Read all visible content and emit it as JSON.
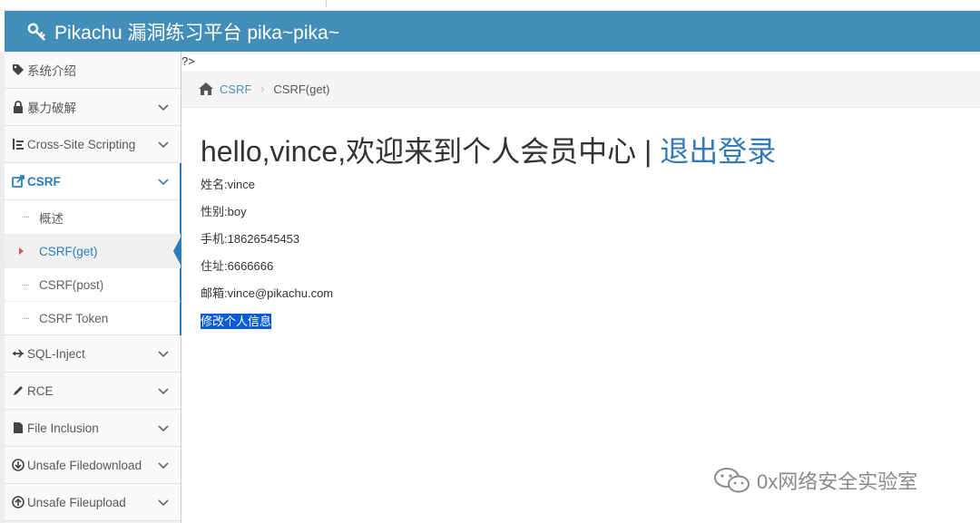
{
  "app": {
    "title": "Pikachu 漏洞练习平台 pika~pika~"
  },
  "stray_text": "?>",
  "sidebar": {
    "items": [
      {
        "label": "系统介绍",
        "icon": "tag-icon"
      },
      {
        "label": "暴力破解",
        "icon": "lock-icon"
      },
      {
        "label": "Cross-Site Scripting",
        "icon": "list-icon"
      },
      {
        "label": "CSRF",
        "icon": "share-icon",
        "active": true
      },
      {
        "label": "SQL-Inject",
        "icon": "plane-icon"
      },
      {
        "label": "RCE",
        "icon": "pencil-icon"
      },
      {
        "label": "File Inclusion",
        "icon": "file-icon"
      },
      {
        "label": "Unsafe Filedownload",
        "icon": "download-icon"
      },
      {
        "label": "Unsafe Fileupload",
        "icon": "upload-icon"
      }
    ],
    "csrf_sub": [
      "概述",
      "CSRF(get)",
      "CSRF(post)",
      "CSRF Token"
    ]
  },
  "breadcrumb": {
    "link": "CSRF",
    "current": "CSRF(get)"
  },
  "main": {
    "greeting": "hello,vince,欢迎来到个人会员中心",
    "divider": "|",
    "logout": "退出登录",
    "name": "姓名:vince",
    "gender": "性别:boy",
    "phone": "手机:18626545453",
    "address": "住址:6666666",
    "email": "邮箱:vince@pikachu.com",
    "edit": "修改个人信息"
  },
  "watermark": "0x网络安全实验室",
  "colors": {
    "navbar": "#438eb9",
    "accent": "#2b7dbc",
    "link": "#337ab7"
  }
}
